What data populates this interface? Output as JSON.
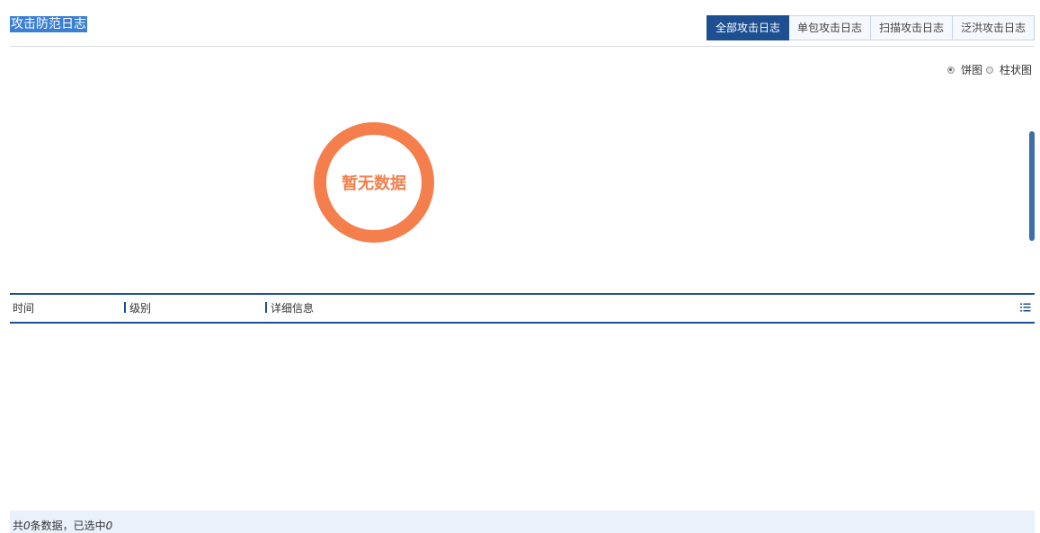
{
  "page": {
    "title": "攻击防范日志"
  },
  "tabs": [
    {
      "label": "全部攻击日志",
      "active": true
    },
    {
      "label": "单包攻击日志",
      "active": false
    },
    {
      "label": "扫描攻击日志",
      "active": false
    },
    {
      "label": "泛洪攻击日志",
      "active": false
    }
  ],
  "chart_type": {
    "options": [
      {
        "label": "饼图",
        "selected": true
      },
      {
        "label": "柱状图",
        "selected": false
      }
    ]
  },
  "chart": {
    "empty_text": "暂无数据",
    "ring_color": "#f47f4d"
  },
  "table": {
    "columns": [
      "时间",
      "级别",
      "详细信息"
    ],
    "rows": []
  },
  "footer": {
    "prefix": "共",
    "total": "0",
    "middle": "条数据，已选中",
    "selected": "0"
  },
  "colors": {
    "accent": "#1d4f91",
    "title_highlight": "#3a7fd5",
    "footer_bg": "#ebf1fa"
  }
}
